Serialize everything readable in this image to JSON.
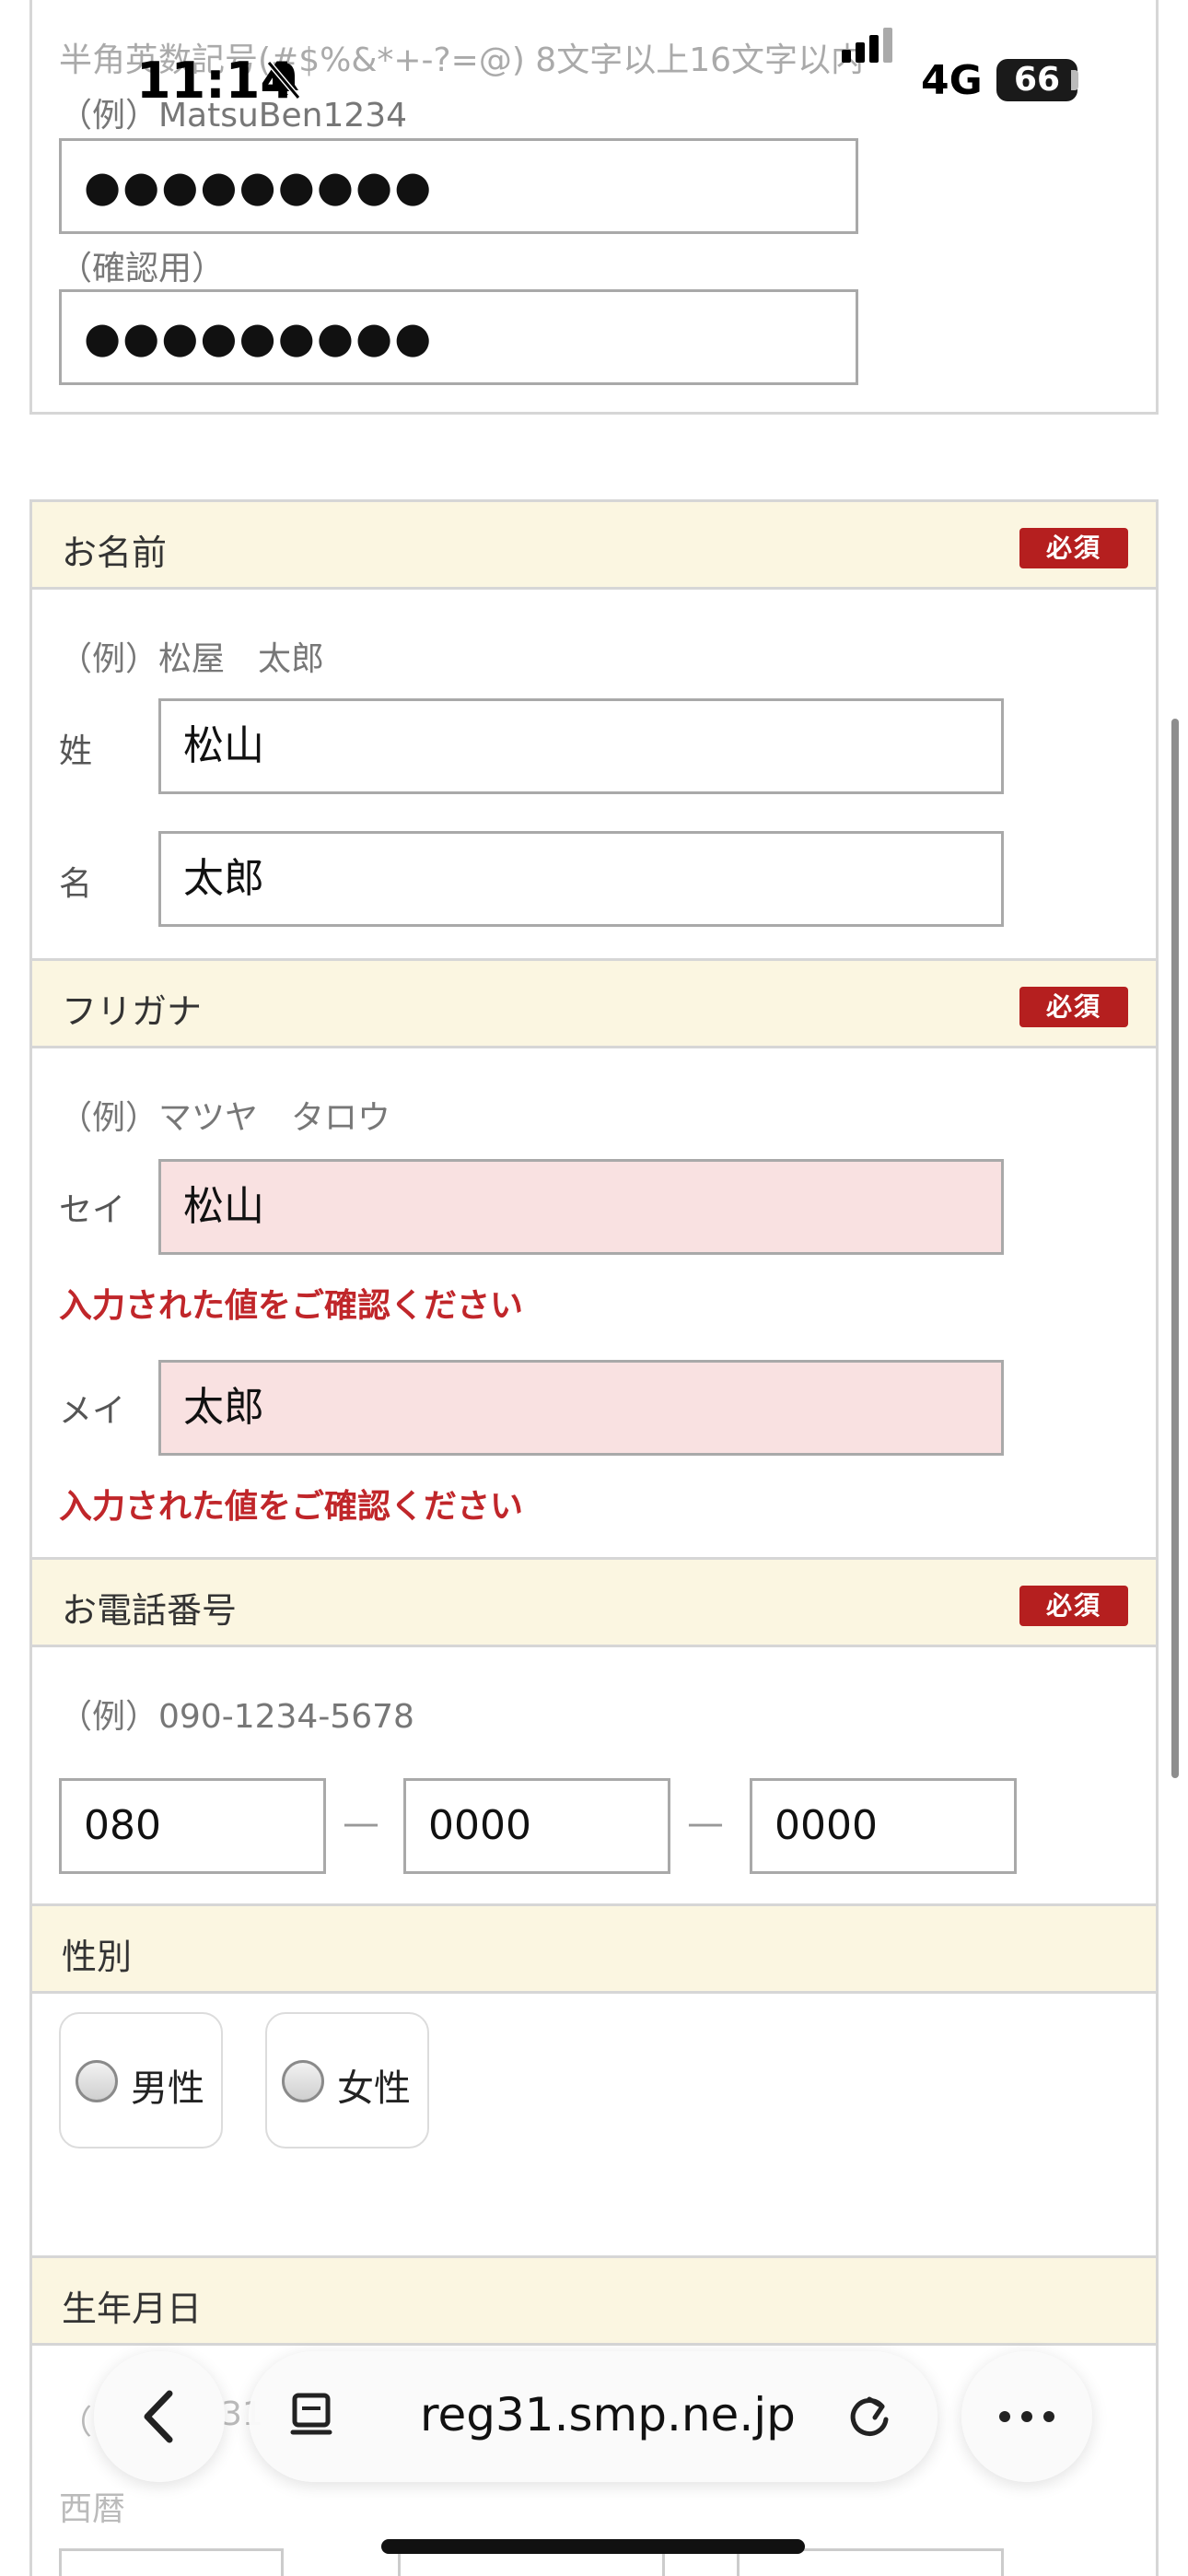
{
  "status_bar": {
    "time": "11:14",
    "network": "4G",
    "battery": "66"
  },
  "password_section": {
    "rule_text": "半角英数記号(#$%&*+-?=@) 8文字以上16文字以内",
    "example": "（例）MatsuBen1234",
    "password_value": "●●●●●●●●●",
    "confirm_label": "（確認用）",
    "confirm_value": "●●●●●●●●●"
  },
  "name_section": {
    "title": "お名前",
    "required": "必須",
    "example": "（例）松屋　太郎",
    "last_label": "姓",
    "last_value": "松山",
    "first_label": "名",
    "first_value": "太郎"
  },
  "furigana_section": {
    "title": "フリガナ",
    "required": "必須",
    "example": "（例）マツヤ　タロウ",
    "sei_label": "セイ",
    "sei_value": "松山",
    "sei_error": "入力された値をご確認ください",
    "mei_label": "メイ",
    "mei_value": "太郎",
    "mei_error": "入力された値をご確認ください"
  },
  "phone_section": {
    "title": "お電話番号",
    "required": "必須",
    "example": "（例）090-1234-5678",
    "part1": "080",
    "part2": "0000",
    "part3": "0000",
    "separator": "—"
  },
  "gender_section": {
    "title": "性別",
    "options": [
      "男性",
      "女性"
    ]
  },
  "birth_section": {
    "title": "生年月日",
    "example_partial": "（",
    "example_tail": "31",
    "era_label": "西暦"
  },
  "browser_toolbar": {
    "url": "reg31.smp.ne.jp"
  }
}
